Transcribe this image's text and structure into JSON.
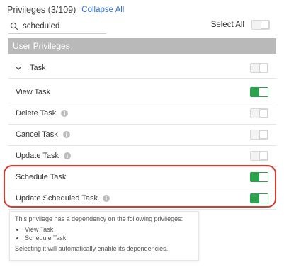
{
  "header": {
    "title": "Privileges (3/109)",
    "collapse_all": "Collapse All"
  },
  "search": {
    "value": "scheduled"
  },
  "select_all": {
    "label": "Select All",
    "checked": false
  },
  "section": {
    "title": "User Privileges"
  },
  "group": {
    "label": "Task",
    "expanded": true,
    "checked": false
  },
  "items": [
    {
      "label": "View Task",
      "info": false,
      "checked": true
    },
    {
      "label": "Delete Task",
      "info": true,
      "checked": false
    },
    {
      "label": "Cancel Task",
      "info": true,
      "checked": false
    },
    {
      "label": "Update Task",
      "info": true,
      "checked": false
    },
    {
      "label": "Schedule Task",
      "info": false,
      "checked": true
    },
    {
      "label": "Update Scheduled Task",
      "info": true,
      "checked": true
    }
  ],
  "tooltip": {
    "intro": "This privilege has a dependency on the following privileges:",
    "deps": [
      "View Task",
      "Schedule Task"
    ],
    "outro": "Selecting it will automatically enable its dependencies."
  },
  "colors": {
    "toggle_on": "#2ca24d",
    "highlight": "#d93a2a",
    "link": "#2f6fd6",
    "section_bar": "#b9b9b9"
  }
}
